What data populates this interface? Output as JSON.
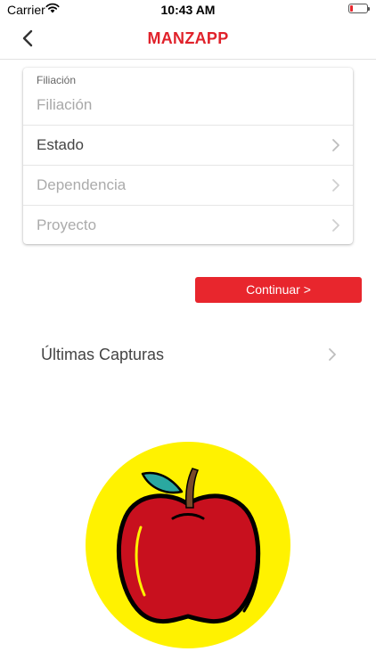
{
  "status_bar": {
    "carrier": "Carrier",
    "time": "10:43 AM",
    "battery_level": 0.15
  },
  "nav": {
    "title": "MANZAPP",
    "back_icon": "chevron-left-icon"
  },
  "form": {
    "filiacion_label": "Filiación",
    "filiacion_placeholder": "Filiación",
    "filiacion_value": "",
    "rows": [
      {
        "label": "Estado",
        "enabled": true
      },
      {
        "label": "Dependencia",
        "enabled": false
      },
      {
        "label": "Proyecto",
        "enabled": false
      }
    ]
  },
  "continue_button": {
    "label": "Continuar >"
  },
  "captures": {
    "label": "Últimas Capturas"
  },
  "colors": {
    "accent": "#e8262d",
    "title_red": "#e0222b",
    "logo_yellow": "#fff200",
    "apple_red": "#c8101e"
  },
  "logo": {
    "icon": "apple-logo"
  }
}
